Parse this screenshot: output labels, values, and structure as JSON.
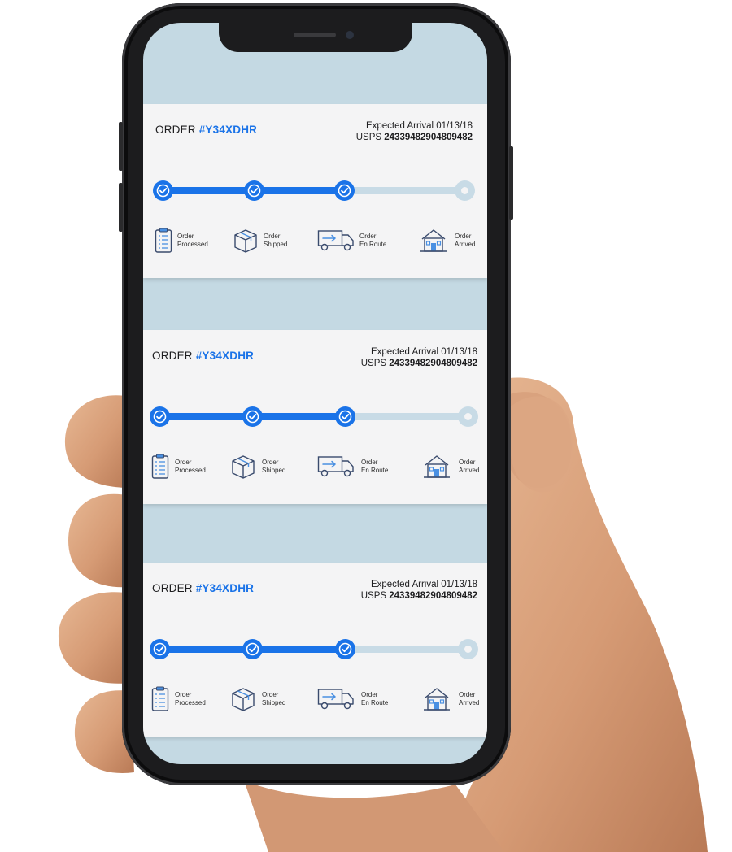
{
  "colors": {
    "accent": "#1a73e8",
    "track_pending": "#c8dbe6",
    "screen_background": "#c4d9e3",
    "card_background": "#f4f4f5",
    "phone_body": "#1c1c1e"
  },
  "orders": [
    {
      "order_prefix": "ORDER",
      "order_number": "#Y34XDHR",
      "expected_arrival": "Expected Arrival 01/13/18",
      "carrier": "USPS",
      "tracking_number": "24339482904809482",
      "progress_completed_steps": 3,
      "progress_total_steps": 4,
      "stages": [
        {
          "line1": "Order",
          "line2": "Processed",
          "icon": "clipboard-icon",
          "done": true
        },
        {
          "line1": "Order",
          "line2": "Shipped",
          "icon": "package-box-icon",
          "done": true
        },
        {
          "line1": "Order",
          "line2": "En Route",
          "icon": "delivery-truck-icon",
          "done": true
        },
        {
          "line1": "Order",
          "line2": "Arrived",
          "icon": "house-icon",
          "done": false
        }
      ]
    },
    {
      "order_prefix": "ORDER",
      "order_number": "#Y34XDHR",
      "expected_arrival": "Expected Arrival 01/13/18",
      "carrier": "USPS",
      "tracking_number": "24339482904809482",
      "progress_completed_steps": 3,
      "progress_total_steps": 4,
      "stages": [
        {
          "line1": "Order",
          "line2": "Processed",
          "icon": "clipboard-icon",
          "done": true
        },
        {
          "line1": "Order",
          "line2": "Shipped",
          "icon": "package-box-icon",
          "done": true
        },
        {
          "line1": "Order",
          "line2": "En Route",
          "icon": "delivery-truck-icon",
          "done": true
        },
        {
          "line1": "Order",
          "line2": "Arrived",
          "icon": "house-icon",
          "done": false
        }
      ]
    },
    {
      "order_prefix": "ORDER",
      "order_number": "#Y34XDHR",
      "expected_arrival": "Expected Arrival 01/13/18",
      "carrier": "USPS",
      "tracking_number": "24339482904809482",
      "progress_completed_steps": 3,
      "progress_total_steps": 4,
      "stages": [
        {
          "line1": "Order",
          "line2": "Processed",
          "icon": "clipboard-icon",
          "done": true
        },
        {
          "line1": "Order",
          "line2": "Shipped",
          "icon": "package-box-icon",
          "done": true
        },
        {
          "line1": "Order",
          "line2": "En Route",
          "icon": "delivery-truck-icon",
          "done": true
        },
        {
          "line1": "Order",
          "line2": "Arrived",
          "icon": "house-icon",
          "done": false
        }
      ]
    }
  ]
}
